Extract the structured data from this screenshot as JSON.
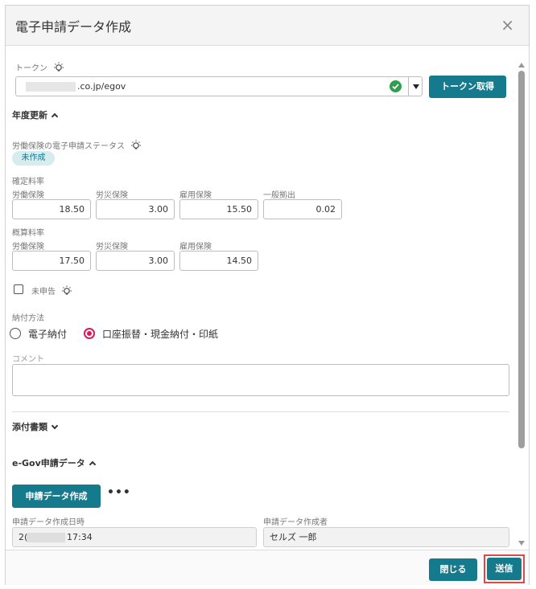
{
  "dialog": {
    "title": "電子申請データ作成",
    "close_glyph": "×"
  },
  "token": {
    "label": "トークン",
    "value_suffix": ".co.jp/egov",
    "button": "トークン取得"
  },
  "annual_update": {
    "header": "年度更新",
    "status_label": "労働保険の電子申請ステータス",
    "status_badge": "未作成",
    "confirmed_rate": {
      "label": "確定料率",
      "fields": [
        {
          "label": "労働保険",
          "value": "18.50"
        },
        {
          "label": "労災保険",
          "value": "3.00"
        },
        {
          "label": "雇用保険",
          "value": "15.50"
        },
        {
          "label": "一般拠出",
          "value": "0.02"
        }
      ]
    },
    "estimated_rate": {
      "label": "概算料率",
      "fields": [
        {
          "label": "労働保険",
          "value": "17.50"
        },
        {
          "label": "労災保険",
          "value": "3.00"
        },
        {
          "label": "雇用保険",
          "value": "14.50"
        }
      ]
    },
    "unfiled_label": "未申告",
    "payment": {
      "label": "納付方法",
      "options": [
        "電子納付",
        "口座振替・現金納付・印紙"
      ],
      "selected": "口座振替・現金納付・印紙"
    },
    "comment_label": "コメント"
  },
  "attachments": {
    "header": "添付書類"
  },
  "egov": {
    "header": "e-Gov申請データ",
    "create_button": "申請データ作成",
    "more_glyph": "•••",
    "created_at": {
      "label": "申請データ作成日時",
      "prefix": "2(",
      "suffix": "17:34"
    },
    "created_by": {
      "label": "申請データ作成者",
      "value": "セルズ 一郎"
    }
  },
  "footer": {
    "close_button": "閉じる",
    "send_button": "送信"
  },
  "colors": {
    "accent": "#157a8c",
    "radio_selected": "#d81b60",
    "success": "#2e9e4f",
    "highlight": "#e04848"
  },
  "icons": [
    "lightbulb-icon",
    "check-circle-icon",
    "caret-down-icon",
    "chevron-up-icon",
    "chevron-down-icon",
    "close-icon",
    "more-icon"
  ]
}
